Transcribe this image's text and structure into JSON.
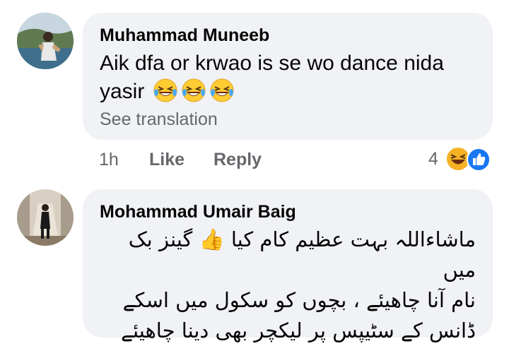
{
  "comments": [
    {
      "author": "Muhammad Muneeb",
      "text": "Aik dfa or krwao is se wo dance nida",
      "text_line2": "yasir",
      "emoji": "😂😂😂",
      "see_translation": "See translation",
      "time": "1h",
      "like_label": "Like",
      "reply_label": "Reply",
      "reaction_count": "4",
      "reactions": [
        "haha",
        "like"
      ]
    },
    {
      "author": "Mohammad Umair Baig",
      "lines": [
        "ماشاءاللہ بہت عظیم کام کیا 👍 گینز بک میں",
        "نام آنا چاهیئے ، بچوں کو سکول میں اسکے",
        "ڈانس کے سٹیپس پر لیکچر بهی دینا چاهیئے"
      ]
    }
  ],
  "colors": {
    "bubble": "#f0f2f5",
    "secondary_text": "#65676b",
    "like_blue": "#1877f2",
    "haha_yellow": "#f7b125"
  }
}
